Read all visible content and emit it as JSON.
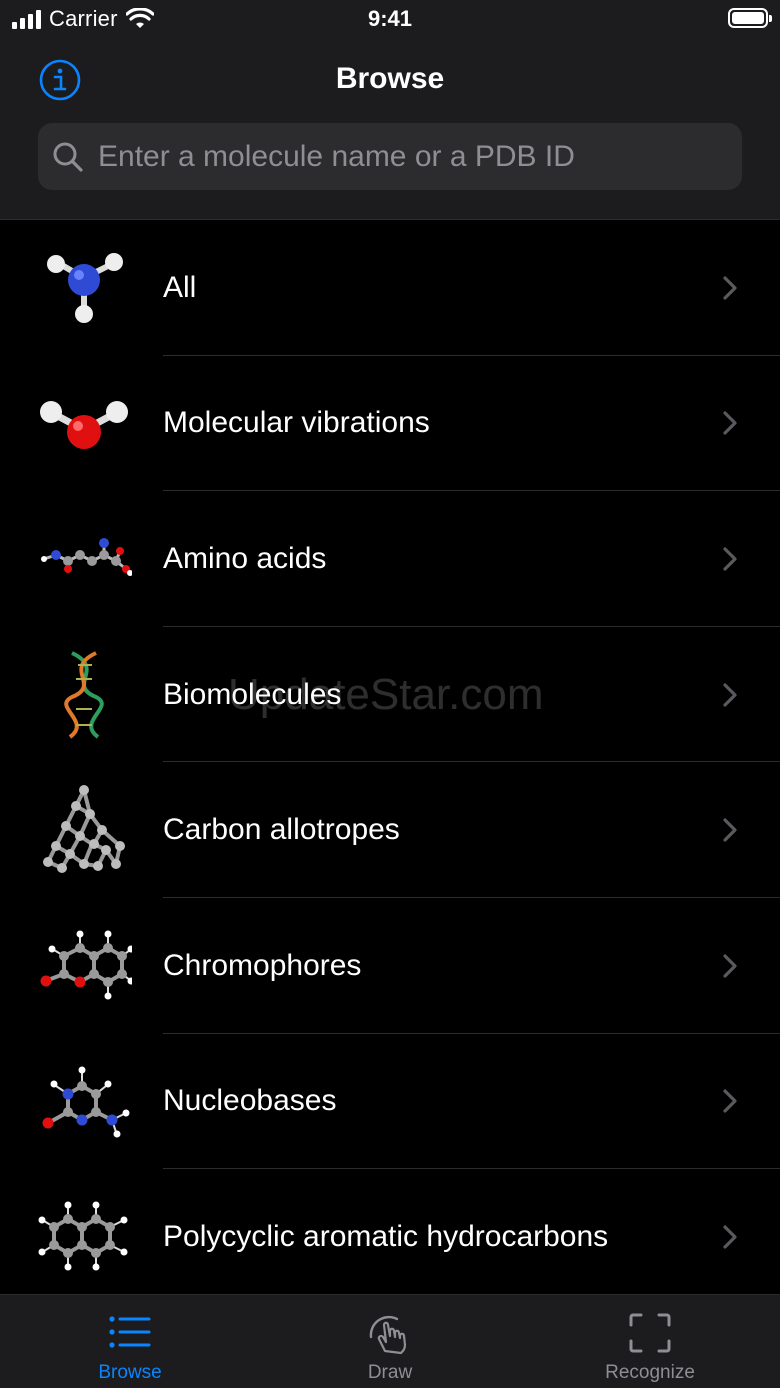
{
  "status_bar": {
    "carrier": "Carrier",
    "time": "9:41"
  },
  "nav": {
    "title": "Browse",
    "info_icon": "info-circle-icon",
    "search_placeholder": "Enter a molecule name or a PDB ID",
    "search_value": ""
  },
  "categories": [
    {
      "label": "All",
      "icon": "ammonia-molecule-icon"
    },
    {
      "label": "Molecular vibrations",
      "icon": "water-molecule-icon"
    },
    {
      "label": "Amino acids",
      "icon": "amino-acid-chain-icon"
    },
    {
      "label": "Biomolecules",
      "icon": "dna-helix-icon"
    },
    {
      "label": "Carbon allotropes",
      "icon": "diamond-lattice-icon"
    },
    {
      "label": "Chromophores",
      "icon": "coumarin-molecule-icon"
    },
    {
      "label": "Nucleobases",
      "icon": "cytosine-molecule-icon"
    },
    {
      "label": "Polycyclic aromatic hydrocarbons",
      "icon": "naphthalene-molecule-icon"
    }
  ],
  "watermark": "UpdateStar.com",
  "tabs": [
    {
      "label": "Browse",
      "icon": "list-icon",
      "active": true
    },
    {
      "label": "Draw",
      "icon": "hand-draw-icon",
      "active": false
    },
    {
      "label": "Recognize",
      "icon": "scan-frame-icon",
      "active": false
    }
  ],
  "colors": {
    "accent": "#0a84ff",
    "background": "#000000",
    "bar_background": "#1c1c1e",
    "secondary_text": "#8e8e93",
    "nitrogen": "#2f4bd6",
    "oxygen": "#e01010",
    "hydrogen": "#ffffff",
    "carbon": "#9a9a9a"
  }
}
